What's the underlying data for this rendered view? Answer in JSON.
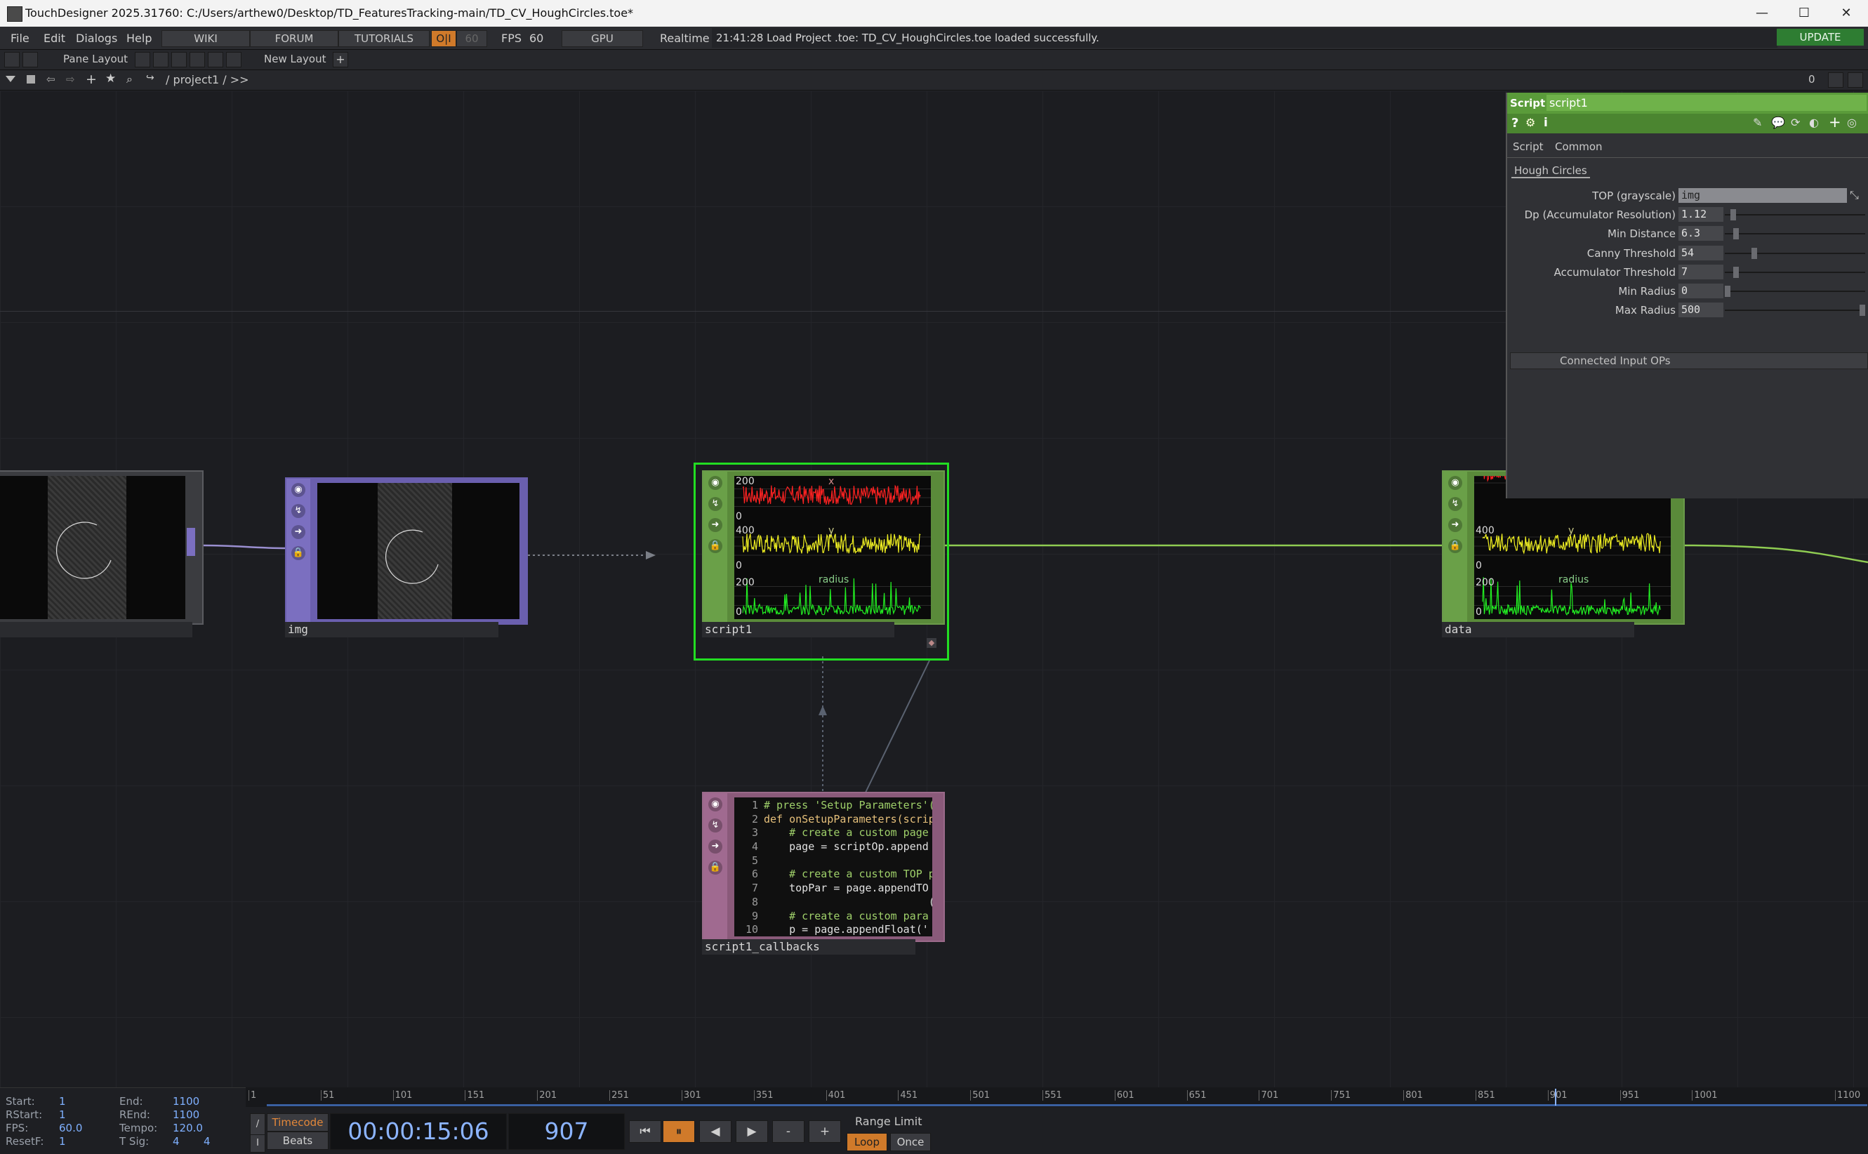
{
  "window": {
    "title": "TouchDesigner 2025.31760: C:/Users/arthew0/Desktop/TD_FeaturesTracking-main/TD_CV_HoughCircles.toe*",
    "minimize": "—",
    "maximize": "☐",
    "close": "✕"
  },
  "menu": {
    "items": [
      "File",
      "Edit",
      "Dialogs",
      "Help"
    ],
    "nav": [
      "WIKI",
      "FORUM",
      "TUTORIALS"
    ],
    "oi": "O|I",
    "fps_cap": "60",
    "fps_label": "FPS",
    "fps_value": "60",
    "gpu": "GPU",
    "realtime": "Realtime",
    "status": "21:41:28 Load Project .toe: TD_CV_HoughCircles.toe loaded successfully.",
    "update": "UPDATE"
  },
  "layout": {
    "pane_layout": "Pane Layout",
    "new_layout": "New Layout",
    "plus": "+"
  },
  "path": {
    "text": "/ project1 / >>",
    "counter": "0"
  },
  "nodes": {
    "source_label": "",
    "img_label": "img",
    "script_label": "script1",
    "callbacks_label": "script1_callbacks",
    "data_label": "data",
    "chart_tick_200": "200",
    "chart_tick_0": "0",
    "chart_tick_400": "400",
    "chart_ch_x": "x",
    "chart_ch_y": "y",
    "chart_ch_radius": "radius",
    "code_numbers": [
      "1",
      "2",
      "3",
      "4",
      "5",
      "6",
      "7",
      "8",
      "9",
      "10"
    ],
    "code_lines": [
      "# press 'Setup Parameters'(",
      "def onSetupParameters(scrip",
      "    # create a custom page",
      "    page = scriptOp.append",
      "",
      "    # create a custom TOP p",
      "    topPar = page.appendTO",
      "                          (",
      "    # create a custom para",
      "    p = page.appendFloat('"
    ]
  },
  "params": {
    "op_type": "Script",
    "op_name": "script1",
    "tabs": [
      "Script",
      "Common"
    ],
    "page": "Hough Circles",
    "rows": [
      {
        "label": "TOP (grayscale)",
        "value": "img",
        "level": null
      },
      {
        "label": "Dp (Accumulator Resolution)",
        "value": "1.12",
        "level": 0.04
      },
      {
        "label": "Min Distance",
        "value": "6.3",
        "level": 0.06
      },
      {
        "label": "Canny Threshold",
        "value": "54",
        "level": 0.2
      },
      {
        "label": "Accumulator Threshold",
        "value": "7",
        "level": 0.06
      },
      {
        "label": "Min Radius",
        "value": "0",
        "level": 0.0
      },
      {
        "label": "Max Radius",
        "value": "500",
        "level": 1.0
      }
    ],
    "connected": "Connected Input OPs"
  },
  "stats": {
    "start_label": "Start:",
    "start": "1",
    "rstart_label": "RStart:",
    "rstart": "1",
    "fps_label": "FPS:",
    "fps": "60.0",
    "resetf_label": "ResetF:",
    "resetf": "1",
    "end_label": "End:",
    "end": "1100",
    "rend_label": "REnd:",
    "rend": "1100",
    "tempo_label": "Tempo:",
    "tempo": "120.0",
    "tsig_label": "T Sig:",
    "tsig_a": "4",
    "tsig_b": "4"
  },
  "timeline": {
    "ticks": [
      "1",
      "51",
      "101",
      "151",
      "201",
      "251",
      "301",
      "351",
      "401",
      "451",
      "501",
      "551",
      "601",
      "651",
      "701",
      "751",
      "801",
      "851",
      "901",
      "951",
      "1001",
      "1100"
    ],
    "current_frame_fraction": 0.8236
  },
  "transport": {
    "timecode": "Timecode",
    "beats": "Beats",
    "time": "00:00:15:06",
    "frame": "907",
    "range_limit": "Range Limit",
    "loop": "Loop",
    "once": "Once",
    "minus": "-",
    "plus": "+"
  },
  "colors": {
    "accent_green": "#5a9b3a",
    "selected_border": "#22dd22",
    "series_x": "#ff2222",
    "series_y": "#eeee22",
    "series_radius": "#22ee22"
  }
}
